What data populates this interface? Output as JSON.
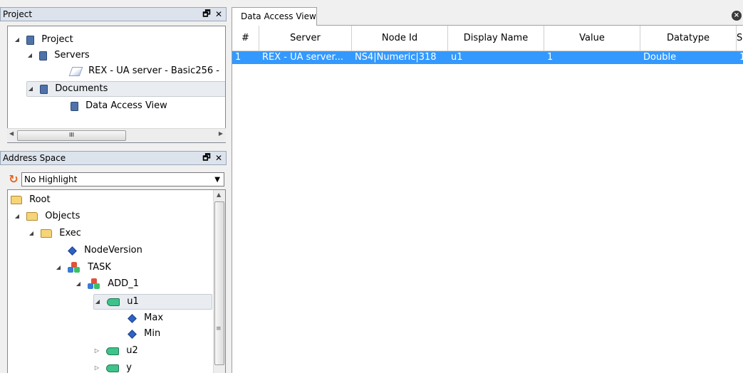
{
  "project_panel": {
    "title": "Project",
    "float_icon": "restore-icon",
    "close_label": "✕",
    "tree": {
      "root": "Project",
      "servers": "Servers",
      "server_item": "REX - UA server - Basic256 -",
      "documents": "Documents",
      "document_item": "Data Access View"
    },
    "scroll_grip": "III"
  },
  "address_panel": {
    "title": "Address Space",
    "close_label": "✕",
    "highlight_select": "No Highlight",
    "tree": {
      "root": "Root",
      "objects": "Objects",
      "exec": "Exec",
      "node_version": "NodeVersion",
      "task": "TASK",
      "add1": "ADD_1",
      "u1": "u1",
      "max": "Max",
      "min": "Min",
      "u2": "u2",
      "y": "y"
    },
    "scroll_grip": "≡"
  },
  "view": {
    "tab_label": "Data Access View",
    "close_icon": "close-circle-icon",
    "columns": [
      "#",
      "Server",
      "Node Id",
      "Display Name",
      "Value",
      "Datatype",
      "S"
    ],
    "rows": [
      {
        "index": "1",
        "server": "REX - UA server...",
        "node_id": "NS4|Numeric|318",
        "display_name": "u1",
        "value": "1",
        "datatype": "Double",
        "extra": "1"
      }
    ]
  },
  "colors": {
    "selection": "#3399ff",
    "header_bg": "#dce3ec",
    "accent_refresh": "#e8601c"
  }
}
